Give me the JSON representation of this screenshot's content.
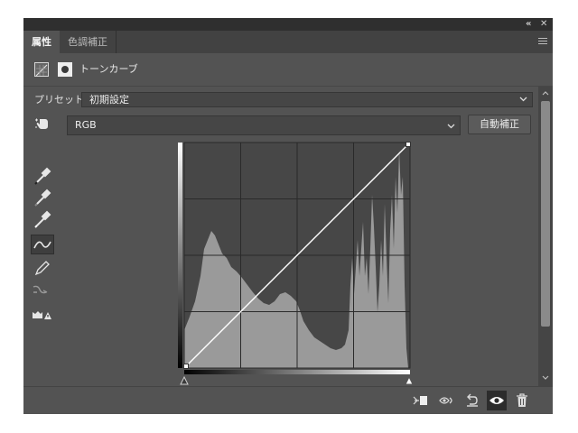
{
  "window": {
    "controls": {
      "collapse": "«",
      "close": "✕"
    },
    "tabs": [
      {
        "label": "属性",
        "active": true
      },
      {
        "label": "色調補正",
        "active": false
      }
    ],
    "menu_icon": "hamburger-menu-icon"
  },
  "header": {
    "title": "トーンカーブ",
    "icons": [
      "curves-adjustment-icon",
      "layer-mask-icon"
    ]
  },
  "preset": {
    "label": "プリセット：",
    "value": "初期設定"
  },
  "channel": {
    "value": "RGB",
    "auto_button": "自動補正"
  },
  "tools": [
    "on-image-adjust-icon",
    "black-point-eyedropper-icon",
    "gray-point-eyedropper-icon",
    "white-point-eyedropper-icon",
    "curve-point-tool-icon",
    "pencil-icon",
    "smooth-curve-icon",
    "clipping-warning-icon"
  ],
  "curve": {
    "input_range": [
      0,
      255
    ],
    "output_range": [
      0,
      255
    ],
    "points": [
      [
        0,
        0
      ],
      [
        255,
        255
      ]
    ]
  },
  "bottom_icons": [
    "clip-to-layer-icon",
    "view-previous-state-icon",
    "reset-icon",
    "toggle-visibility-icon",
    "trash-icon"
  ],
  "colors": {
    "panel_bg": "#535353",
    "tab_bar_bg": "#424242",
    "histogram_fill": "#9a9a9a",
    "graph_bg": "#474747"
  }
}
